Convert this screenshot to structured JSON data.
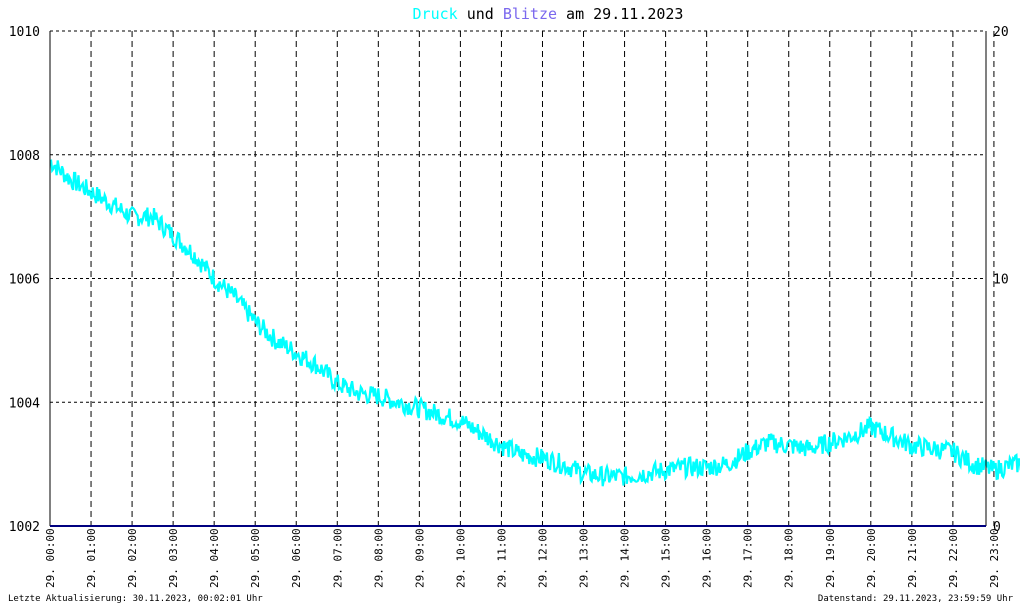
{
  "title": {
    "part1": "Druck",
    "part2": " und ",
    "part3": "Blitze",
    "part4": " am 29.11.2023"
  },
  "footer": {
    "left": "Letzte Aktualisierung: 30.11.2023, 00:02:01 Uhr",
    "right": "Datenstand: 29.11.2023, 23:59:59 Uhr"
  },
  "colors": {
    "background": "#ffffff",
    "pressure": "#00ffff",
    "lightning": "#7b68ee",
    "baseline": "#000080",
    "grid": "#000000",
    "text": "#000000"
  },
  "chart_data": {
    "type": "line",
    "title": "Druck und Blitze am 29.11.2023",
    "grid": true,
    "y_left": {
      "ylim": [
        1002,
        1010
      ],
      "ticks": [
        "1002",
        "1004",
        "1006",
        "1008",
        "1010"
      ]
    },
    "y_right": {
      "ylim": [
        0,
        20
      ],
      "ticks": [
        "0",
        "10",
        "20"
      ]
    },
    "x_labels": [
      "29. 00:00",
      "29. 01:00",
      "29. 02:00",
      "29. 03:00",
      "29. 04:00",
      "29. 05:00",
      "29. 06:00",
      "29. 07:00",
      "29. 08:00",
      "29. 09:00",
      "29. 10:00",
      "29. 11:00",
      "29. 12:00",
      "29. 13:00",
      "29. 14:00",
      "29. 15:00",
      "29. 16:00",
      "29. 17:00",
      "29. 18:00",
      "29. 19:00",
      "29. 20:00",
      "29. 21:00",
      "29. 22:00",
      "29. 23:00"
    ],
    "series": [
      {
        "name": "Druck",
        "axis": "left",
        "x_hours": [
          0,
          0.5,
          1,
          1.5,
          2,
          2.5,
          3,
          3.5,
          4,
          4.5,
          5,
          5.5,
          6,
          6.5,
          7,
          7.5,
          8,
          8.5,
          9,
          9.5,
          10,
          10.5,
          11,
          11.5,
          12,
          12.5,
          13,
          13.5,
          14,
          14.5,
          15,
          15.5,
          16,
          16.5,
          17,
          17.5,
          18,
          18.5,
          19,
          19.5,
          20,
          20.5,
          21,
          21.5,
          22,
          22.5,
          23,
          23.5,
          24
        ],
        "values": [
          1007.9,
          1007.6,
          1007.4,
          1007.2,
          1007.0,
          1007.0,
          1006.7,
          1006.4,
          1006.0,
          1005.7,
          1005.3,
          1005.0,
          1004.8,
          1004.6,
          1004.3,
          1004.15,
          1004.1,
          1004.0,
          1003.9,
          1003.8,
          1003.7,
          1003.5,
          1003.3,
          1003.15,
          1003.1,
          1003.0,
          1002.85,
          1002.8,
          1002.8,
          1002.85,
          1002.9,
          1002.95,
          1002.95,
          1003.0,
          1003.2,
          1003.35,
          1003.3,
          1003.25,
          1003.35,
          1003.45,
          1003.6,
          1003.45,
          1003.3,
          1003.25,
          1003.2,
          1003.0,
          1002.9,
          1003.0,
          1003.0
        ]
      },
      {
        "name": "Blitze",
        "axis": "right",
        "x_hours": [
          0,
          24
        ],
        "values": [
          0,
          0
        ]
      }
    ]
  }
}
